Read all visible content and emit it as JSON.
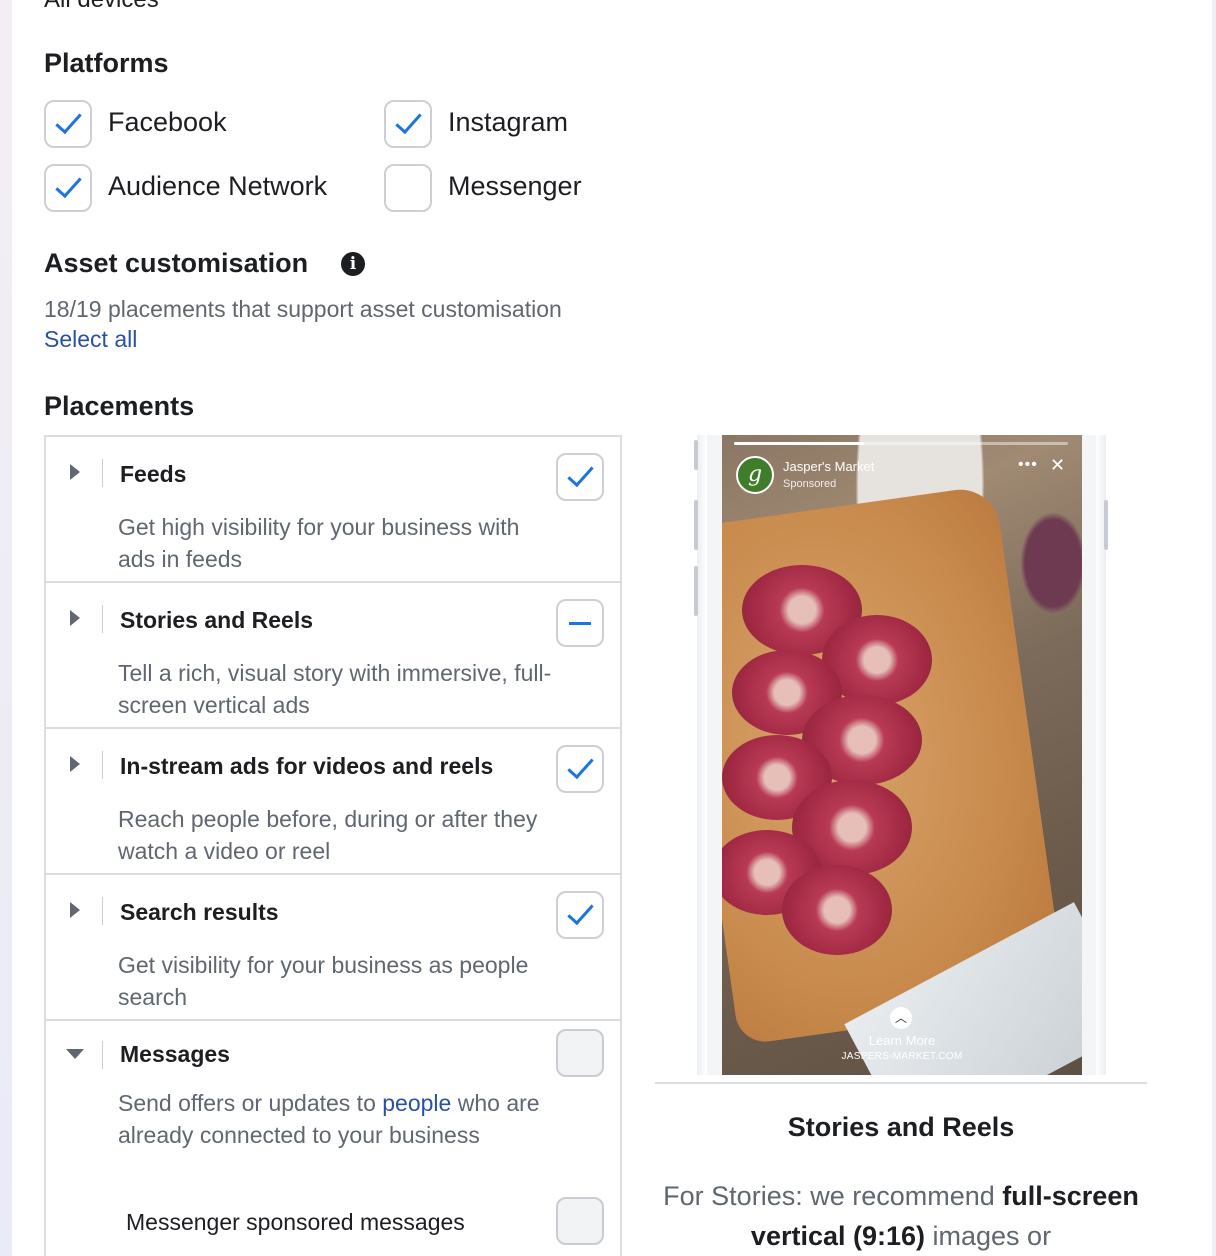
{
  "top_partial_heading": "All devices",
  "platforms": {
    "title": "Platforms",
    "items": [
      {
        "label": "Facebook",
        "checked": true
      },
      {
        "label": "Instagram",
        "checked": true
      },
      {
        "label": "Audience Network",
        "checked": true
      },
      {
        "label": "Messenger",
        "checked": false
      }
    ]
  },
  "asset_customisation": {
    "title": "Asset customisation",
    "info_icon": "info-icon",
    "summary": "18/19 placements that support asset customisation",
    "select_all": "Select all"
  },
  "placements": {
    "title": "Placements",
    "rows": [
      {
        "title": "Feeds",
        "desc": "Get high visibility for your business with ads in feeds",
        "state": "checked",
        "expanded": false
      },
      {
        "title": "Stories and Reels",
        "desc": "Tell a rich, visual story with immersive, full-screen vertical ads",
        "state": "indeterminate",
        "expanded": false
      },
      {
        "title": "In-stream ads for videos and reels",
        "desc": "Reach people before, during or after they watch a video or reel",
        "state": "checked",
        "expanded": false
      },
      {
        "title": "Search results",
        "desc": "Get visibility for your business as people search",
        "state": "checked",
        "expanded": false
      },
      {
        "title": "Messages",
        "desc_before": "Send offers or updates to ",
        "desc_link": "people",
        "desc_after": " who are already connected to your business",
        "state": "disabled",
        "expanded": true,
        "sub_items": [
          {
            "label": "Messenger sponsored messages",
            "state": "disabled"
          }
        ]
      }
    ]
  },
  "preview": {
    "brand_name": "Jasper's Market",
    "brand_logo_letter": "g",
    "sponsored": "Sponsored",
    "more_icon": "more-icon",
    "close_icon": "close-icon",
    "progress": 0.39,
    "cta": "Learn More",
    "domain": "JASPERS-MARKET.COM",
    "title": "Stories and Reels",
    "desc_part1": "For Stories: we recommend ",
    "desc_bold": "full-screen vertical (9:16)",
    "desc_part2": " images or"
  },
  "colors": {
    "accent": "#1b74e4",
    "link": "#2851a3",
    "muted_text": "#606770",
    "border": "#dadde1"
  }
}
